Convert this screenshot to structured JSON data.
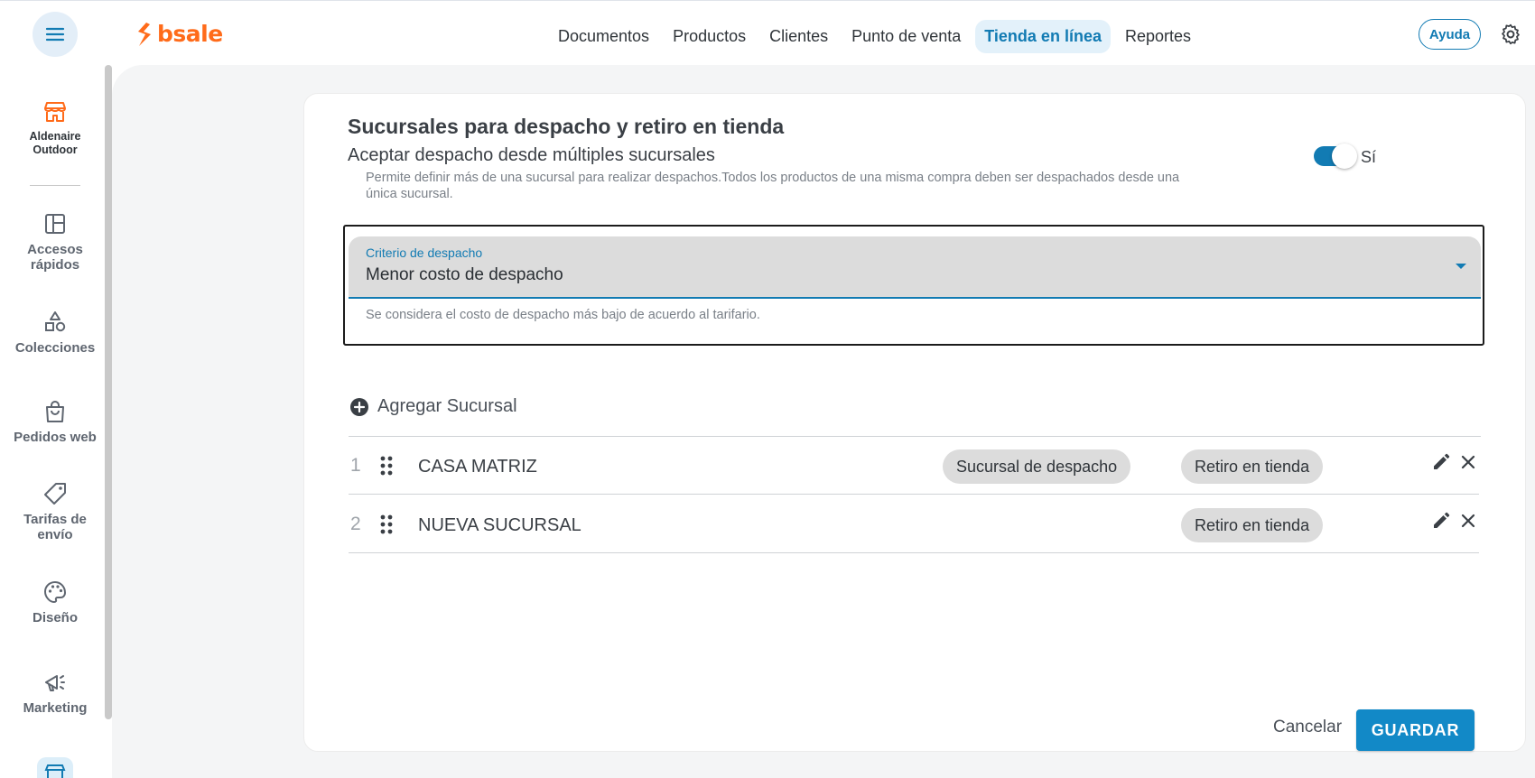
{
  "brand": {
    "name": "bsale",
    "color": "#ff6b1a"
  },
  "nav": {
    "items": [
      {
        "label": "Documentos"
      },
      {
        "label": "Productos"
      },
      {
        "label": "Clientes"
      },
      {
        "label": "Punto de venta"
      },
      {
        "label": "Tienda en línea",
        "active": true
      },
      {
        "label": "Reportes"
      }
    ],
    "help_label": "Ayuda"
  },
  "sidebar": {
    "store_name_line1": "Aldenaire",
    "store_name_line2": "Outdoor",
    "items": [
      {
        "label_line1": "Accesos",
        "label_line2": "rápidos",
        "icon": "dashboard-icon"
      },
      {
        "label_line1": "Colecciones",
        "label_line2": "",
        "icon": "shapes-icon"
      },
      {
        "label_line1": "Pedidos web",
        "label_line2": "",
        "icon": "shopping-bag-icon"
      },
      {
        "label_line1": "Tarifas de",
        "label_line2": "envío",
        "icon": "tag-icon"
      },
      {
        "label_line1": "Diseño",
        "label_line2": "",
        "icon": "palette-icon"
      },
      {
        "label_line1": "Marketing",
        "label_line2": "",
        "icon": "megaphone-icon"
      }
    ]
  },
  "section": {
    "title": "Sucursales para despacho y retiro en tienda",
    "multi_branch_label": "Aceptar despacho desde múltiples sucursales",
    "multi_branch_desc": "Permite definir más de una sucursal para realizar despachos.Todos los productos de una misma compra deben ser despachados desde una única sucursal.",
    "toggle_on": true,
    "toggle_label": "Sí"
  },
  "dispatch_criteria": {
    "caption": "Criterio de despacho",
    "value": "Menor costo de despacho",
    "help": "Se considera el costo de despacho más bajo de acuerdo al tarifario."
  },
  "branches": {
    "add_label": "Agregar Sucursal",
    "rows": [
      {
        "num": "1",
        "name": "CASA MATRIZ",
        "dispatch_chip": "Sucursal de despacho",
        "pickup_chip": "Retiro en tienda"
      },
      {
        "num": "2",
        "name": "NUEVA SUCURSAL",
        "dispatch_chip": "",
        "pickup_chip": "Retiro en tienda"
      }
    ]
  },
  "actions": {
    "cancel_label": "Cancelar",
    "save_label": "GUARDAR"
  },
  "colors": {
    "accent": "#127bb3",
    "primary_button": "#1289c7",
    "chip_bg": "#dcdcdc"
  }
}
